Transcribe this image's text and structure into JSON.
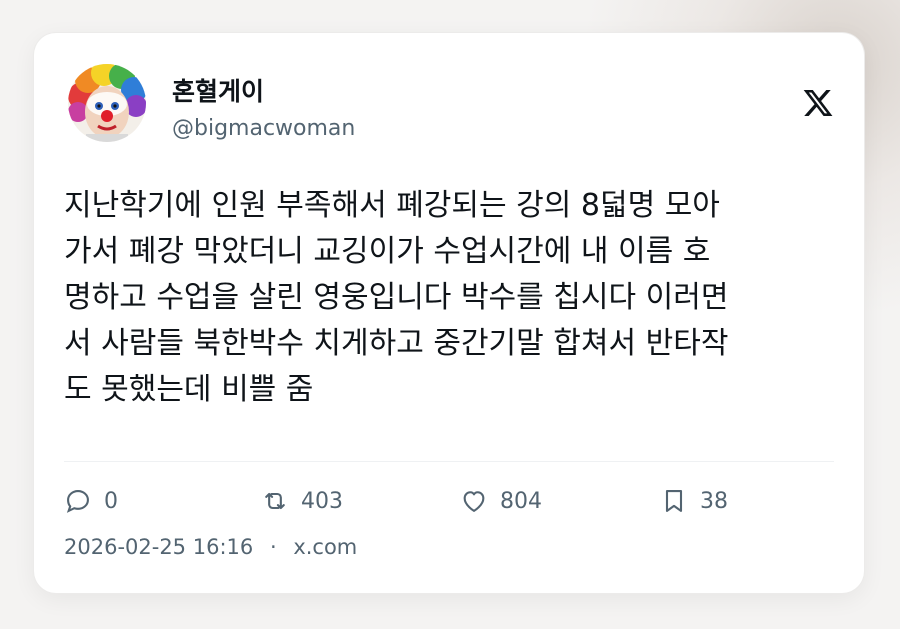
{
  "tweet": {
    "author_name": "혼혈게이",
    "author_handle": "@bigmacwoman",
    "text": "지난학기에 인원 부족해서 폐강되는 강의 8덟명 모아\n가서 폐강 막았더니 교깅이가 수업시간에 내 이름 호\n명하고 수업을 살린 영웅입니다 박수를 칩시다 이러면\n서 사람들 북한박수 치게하고 중간기말 합쳐서 반타작\n도 못했는데 비쁠 줌",
    "replies": "0",
    "retweets": "403",
    "likes": "804",
    "bookmarks": "38",
    "timestamp": "2026-02-25 16:16",
    "separator": "·",
    "source": "x.com"
  },
  "icons": {
    "platform": "x-logo-icon",
    "reply": "reply-icon",
    "retweet": "retweet-icon",
    "like": "heart-icon",
    "bookmark": "bookmark-icon"
  },
  "colors": {
    "text_primary": "#0f1419",
    "text_secondary": "#536471",
    "card_background": "#ffffff",
    "page_background": "#f4f3f2"
  }
}
